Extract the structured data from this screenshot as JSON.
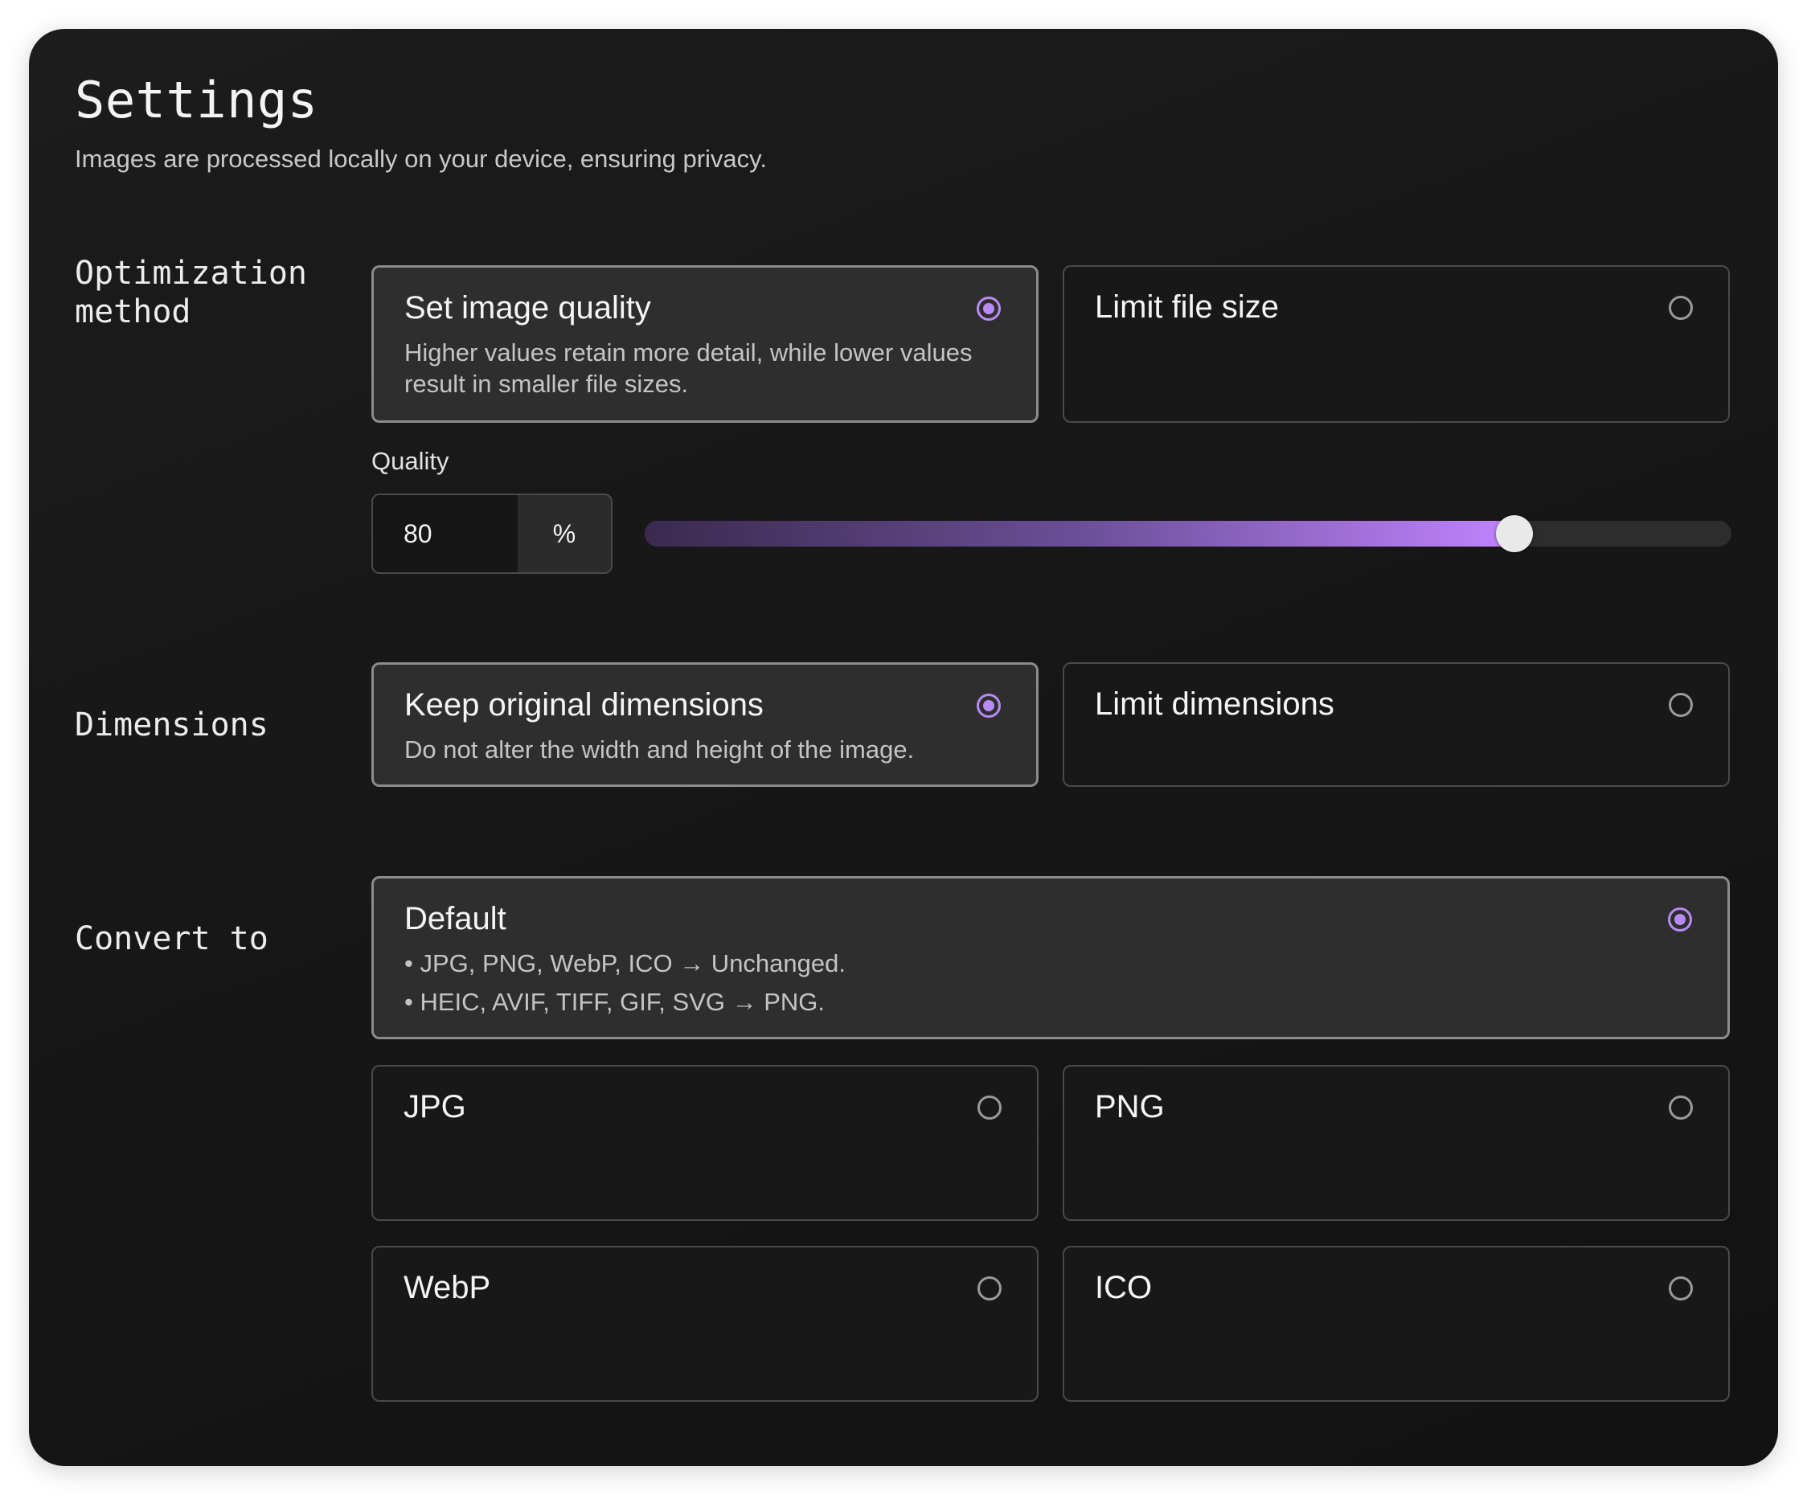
{
  "header": {
    "title": "Settings",
    "subtitle": "Images are processed locally on your device, ensuring privacy."
  },
  "optimization": {
    "label_line1": "Optimization",
    "label_line2": "method",
    "options": [
      {
        "title": "Set image quality",
        "description": "Higher values retain more detail, while lower values result in smaller file sizes.",
        "selected": true
      },
      {
        "title": "Limit file size",
        "selected": false
      }
    ],
    "quality": {
      "label": "Quality",
      "value": "80",
      "unit": "%",
      "slider_percent": 80
    }
  },
  "dimensions": {
    "label": "Dimensions",
    "options": [
      {
        "title": "Keep original dimensions",
        "description": "Do not alter the width and height of the image.",
        "selected": true
      },
      {
        "title": "Limit dimensions",
        "selected": false
      }
    ]
  },
  "convert": {
    "label": "Convert to",
    "default": {
      "title": "Default",
      "line1": "• JPG, PNG, WebP, ICO → Unchanged.",
      "line2": "• HEIC, AVIF, TIFF, GIF, SVG → PNG.",
      "selected": true
    },
    "formats": [
      {
        "title": "JPG",
        "selected": false
      },
      {
        "title": "PNG",
        "selected": false
      },
      {
        "title": "WebP",
        "selected": false
      },
      {
        "title": "ICO",
        "selected": false
      }
    ]
  },
  "colors": {
    "accent": "#b98af5",
    "panel_background": "#181818",
    "selected_card": "#2e2e2e"
  }
}
